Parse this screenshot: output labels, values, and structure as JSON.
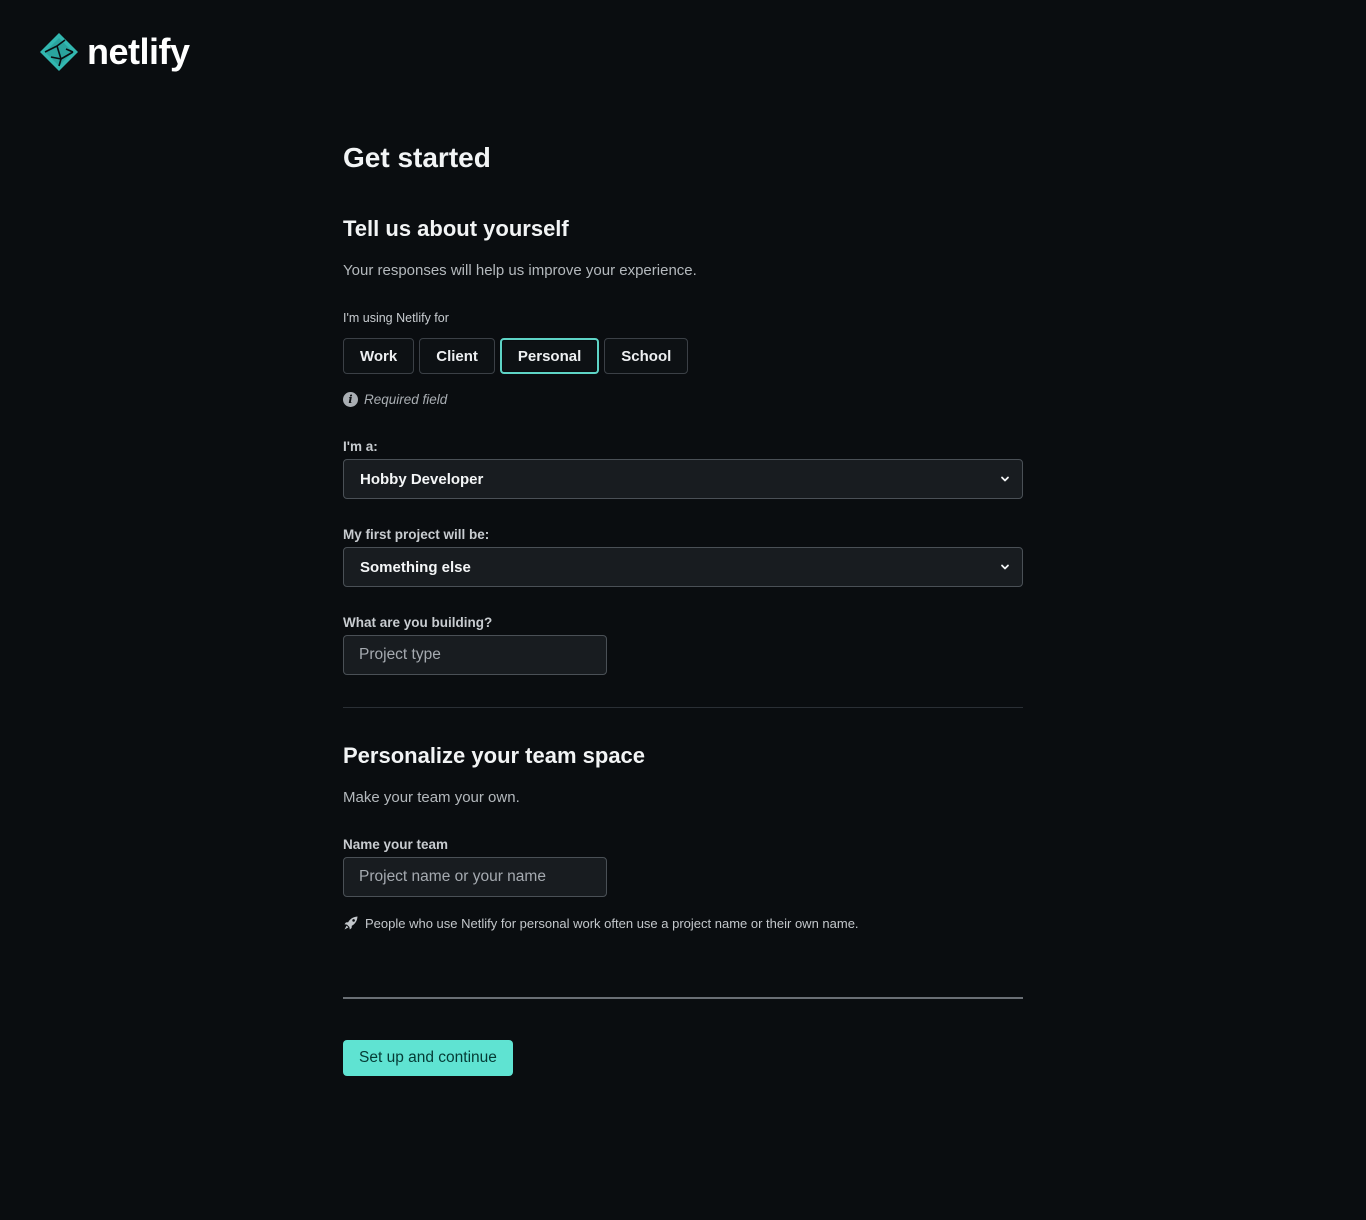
{
  "brand": {
    "name": "netlify",
    "accent": "#5fe3d2",
    "logo_color": "#32b7b0"
  },
  "page": {
    "title": "Get started"
  },
  "about": {
    "title": "Tell us about yourself",
    "description": "Your responses will help us improve your experience.",
    "usage_label": "I'm using Netlify for",
    "usage_options": [
      "Work",
      "Client",
      "Personal",
      "School"
    ],
    "usage_selected": "Personal",
    "required_text": "Required field",
    "role_label": "I'm a:",
    "role_value": "Hobby Developer",
    "project_label": "My first project will be:",
    "project_value": "Something else",
    "building_label": "What are you building?",
    "building_placeholder": "Project type"
  },
  "team": {
    "title": "Personalize your team space",
    "description": "Make your team your own.",
    "name_label": "Name your team",
    "name_placeholder": "Project name or your name",
    "hint": "People who use Netlify for personal work often use a project name or their own name."
  },
  "actions": {
    "submit_label": "Set up and continue"
  }
}
